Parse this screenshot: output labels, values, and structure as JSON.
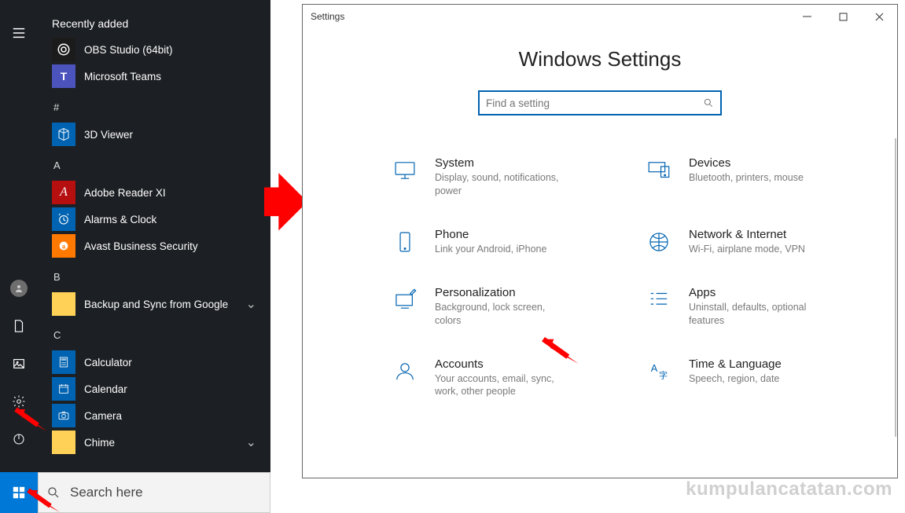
{
  "start_menu": {
    "recent_header": "Recently added",
    "letter_hash": "#",
    "letter_a": "A",
    "letter_b": "B",
    "letter_c": "C",
    "recent": [
      {
        "name": "OBS Studio (64bit)",
        "icon": "obs"
      },
      {
        "name": "Microsoft Teams",
        "icon": "teams"
      }
    ],
    "hash_apps": [
      {
        "name": "3D Viewer",
        "icon": "3d"
      }
    ],
    "a_apps": [
      {
        "name": "Adobe Reader XI",
        "icon": "adobe"
      },
      {
        "name": "Alarms & Clock",
        "icon": "alarm"
      },
      {
        "name": "Avast Business Security",
        "icon": "avast"
      }
    ],
    "b_apps": [
      {
        "name": "Backup and Sync from Google",
        "icon": "folder",
        "expandable": true
      }
    ],
    "c_apps": [
      {
        "name": "Calculator",
        "icon": "calc"
      },
      {
        "name": "Calendar",
        "icon": "cal"
      },
      {
        "name": "Camera",
        "icon": "cam"
      },
      {
        "name": "Chime",
        "icon": "folder",
        "expandable": true
      }
    ]
  },
  "rail": {
    "hamburger": "≡",
    "user": "user",
    "documents": "documents",
    "pictures": "pictures",
    "settings": "settings",
    "power": "power"
  },
  "taskbar": {
    "search_placeholder": "Search here"
  },
  "settings_window": {
    "title": "Settings",
    "heading": "Windows Settings",
    "search_placeholder": "Find a setting",
    "categories": [
      {
        "title": "System",
        "desc": "Display, sound, notifications, power",
        "icon": "system"
      },
      {
        "title": "Devices",
        "desc": "Bluetooth, printers, mouse",
        "icon": "devices"
      },
      {
        "title": "Phone",
        "desc": "Link your Android, iPhone",
        "icon": "phone"
      },
      {
        "title": "Network & Internet",
        "desc": "Wi-Fi, airplane mode, VPN",
        "icon": "network"
      },
      {
        "title": "Personalization",
        "desc": "Background, lock screen, colors",
        "icon": "personalization"
      },
      {
        "title": "Apps",
        "desc": "Uninstall, defaults, optional features",
        "icon": "apps"
      },
      {
        "title": "Accounts",
        "desc": "Your accounts, email, sync, work, other people",
        "icon": "accounts"
      },
      {
        "title": "Time & Language",
        "desc": "Speech, region, date",
        "icon": "time"
      }
    ]
  },
  "watermark": "kumpulancatatan.com"
}
